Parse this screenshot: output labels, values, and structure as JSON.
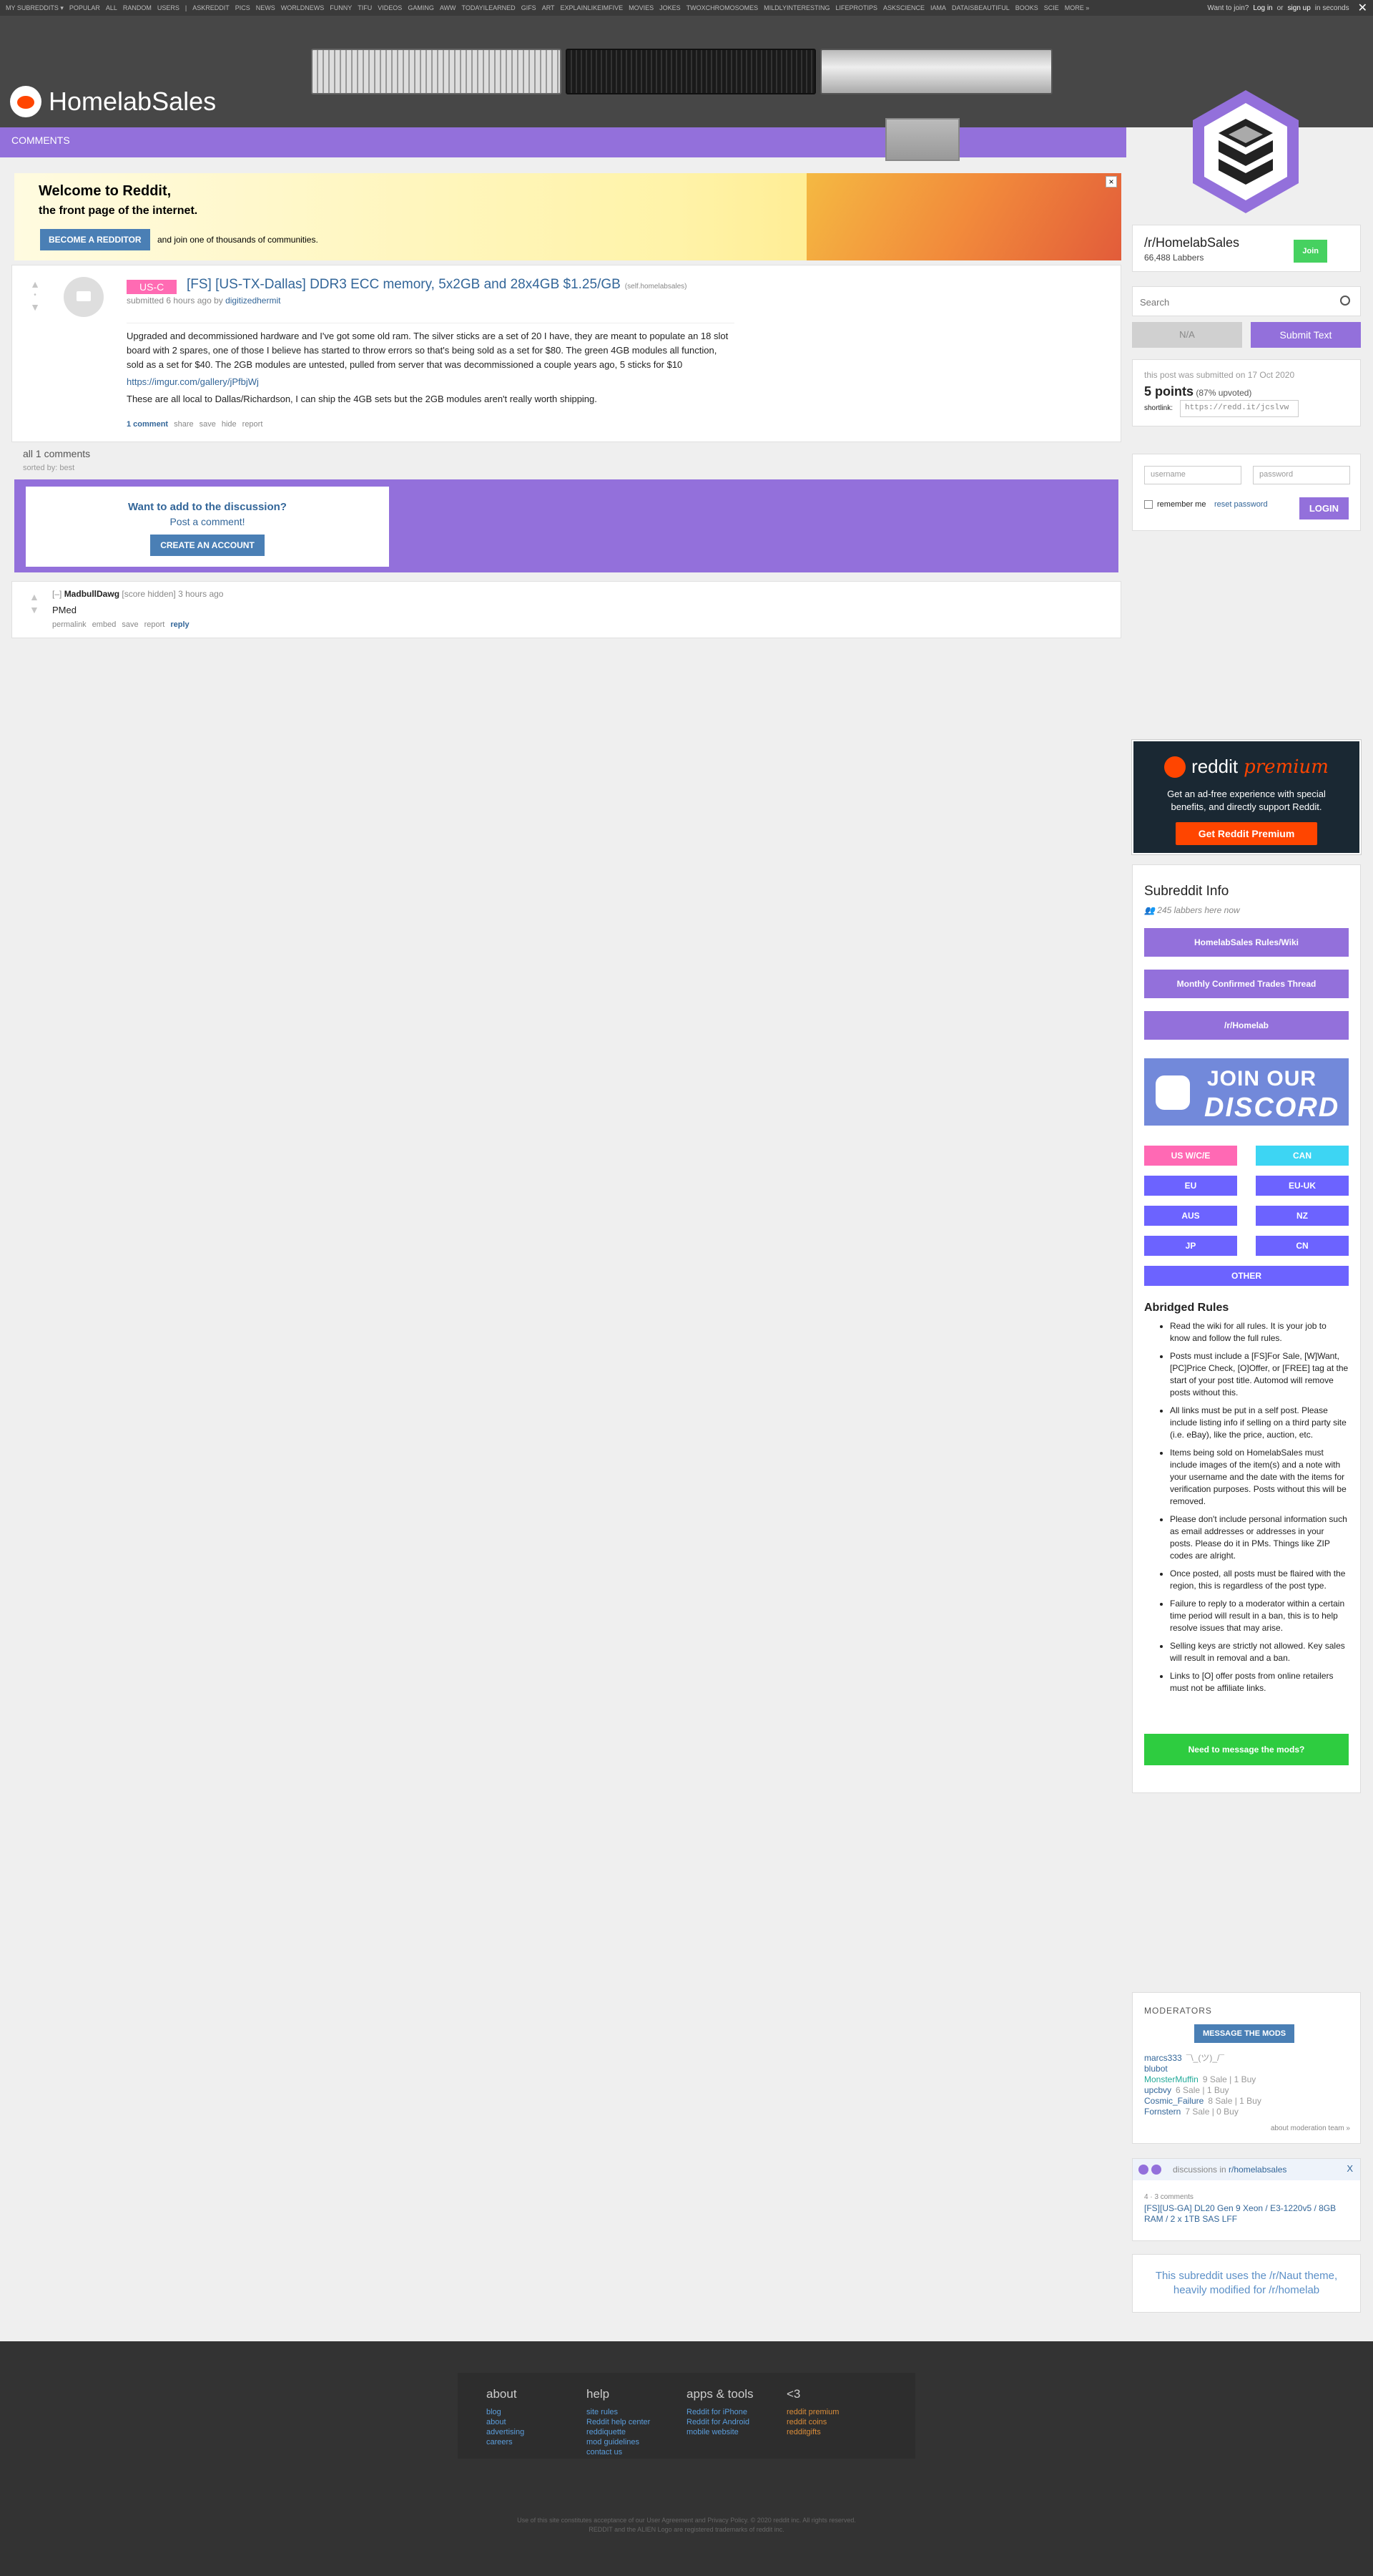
{
  "topbar": {
    "links": [
      "MY SUBREDDITS ▾",
      "POPULAR",
      "ALL",
      "RANDOM",
      "USERS",
      "|",
      "ASKREDDIT",
      "PICS",
      "NEWS",
      "WORLDNEWS",
      "FUNNY",
      "TIFU",
      "VIDEOS",
      "GAMING",
      "AWW",
      "TODAYILEARNED",
      "GIFS",
      "ART",
      "EXPLAINLIKEIMFIVE",
      "MOVIES",
      "JOKES",
      "TWOXCHROMOSOMES",
      "MILDLYINTERESTING",
      "LIFEPROTIPS",
      "ASKSCIENCE",
      "IAMA",
      "DATAISBEAUTIFUL",
      "BOOKS",
      "SCIE",
      "MORE »"
    ],
    "want_join": "Want to join?",
    "login": "Log in",
    "or": "or",
    "signup": "sign up",
    "tail": "in seconds",
    "close": "✕"
  },
  "header": {
    "title": "HomelabSales",
    "tab": "comments"
  },
  "welcome": {
    "title": "Welcome to Reddit,",
    "subtitle": "the front page of the internet.",
    "button": "Become a Redditor",
    "join": "and join one of thousands of communities.",
    "close": "×"
  },
  "post": {
    "flair": "US-C",
    "title": "[FS] [US-TX-Dallas] DDR3 ECC memory, 5x2GB and 28x4GB $1.25/GB",
    "domain": "(self.homelabsales)",
    "submitted": "submitted 6 hours ago by",
    "author": "digitizedhermit",
    "body1": "Upgraded and decommissioned hardware and I've got some old ram. The silver sticks are a set of 20 I have, they are meant to populate an 18 slot board with 2 spares, one of those I believe has started to throw errors so that's being sold as a set for $80. The green 4GB modules all function, sold as a set for $40. The 2GB modules are untested, pulled from server that was decommissioned a couple years ago, 5 sticks for $10",
    "link": "https://imgur.com/gallery/jPfbjWj",
    "body2": "These are all local to Dallas/Richardson, I can ship the 4GB sets but the 2GB modules aren't really worth shipping.",
    "score": "•",
    "actions": {
      "comments": "1 comment",
      "share": "share",
      "save": "save",
      "hide": "hide",
      "report": "report"
    }
  },
  "comments_area": {
    "all": "all 1 comments",
    "sorted": "sorted by: best",
    "discuss_q": "Want to add to the discussion?",
    "post_comment": "Post a comment!",
    "create": "Create an account"
  },
  "comment": {
    "toggle": "[–]",
    "author": "MadbullDawg",
    "meta": "[score hidden] 3 hours ago",
    "text": "PMed",
    "actions": {
      "permalink": "permalink",
      "embed": "embed",
      "save": "save",
      "report": "report",
      "reply": "reply"
    }
  },
  "sidebar": {
    "name": "/r/HomelabSales",
    "subscribers": "66,488 Labbers",
    "join": "Join",
    "search_placeholder": "Search",
    "na": "N/A",
    "submit": "Submit Text",
    "submitted_on": "this post was submitted on 17 Oct 2020",
    "points": "5 points",
    "upvoted": "(87% upvoted)",
    "shortlink_label": "shortlink:",
    "shortlink": "https://redd.it/jcslvw",
    "username_ph": "username",
    "password_ph": "password",
    "remember": "remember me",
    "reset": "reset password",
    "login": "LOGIN"
  },
  "premium": {
    "reddit": "reddit",
    "premium": "premium",
    "desc": "Get an ad-free experience with special benefits, and directly support Reddit.",
    "button": "Get Reddit Premium"
  },
  "subinfo": {
    "title": "Subreddit Info",
    "here": "245 labbers here now",
    "buttons": [
      "HomelabSales Rules/Wiki",
      "Monthly Confirmed Trades Thread",
      "/r/Homelab"
    ],
    "discord_1": "JOIN OUR",
    "discord_2": "DISCORD",
    "regions": [
      "US W/C/E",
      "CAN",
      "EU",
      "EU-UK",
      "AUS",
      "NZ",
      "JP",
      "CN",
      "OTHER"
    ],
    "rules_title": "Abridged Rules",
    "rules": [
      "Read the wiki for all rules. It is your job to know and follow the full rules.",
      "Posts must include a [FS]For Sale, [W]Want, [PC]Price Check, [O]Offer, or [FREE] tag at the start of your post title. Automod will remove posts without this.",
      "All links must be put in a self post. Please include listing info if selling on a third party site (i.e. eBay), like the price, auction, etc.",
      "Items being sold on HomelabSales must include images of the item(s) and a note with your username and the date with the items for verification purposes. Posts without this will be removed.",
      "Please don't include personal information such as email addresses or addresses in your posts. Please do it in PMs. Things like ZIP codes are alright.",
      "Once posted, all posts must be flaired with the region, this is regardless of the post type.",
      "Failure to reply to a moderator within a certain time period will result in a ban, this is to help resolve issues that may arise.",
      "Selling keys are strictly not allowed. Key sales will result in removal and a ban.",
      "Links to [O] offer posts from online retailers must not be affiliate links."
    ],
    "need_mods": "Need to message the mods?"
  },
  "mods": {
    "title": "MODERATORS",
    "message": "MESSAGE THE MODS",
    "list": [
      {
        "name": "marcs333",
        "flair": "¯\\_(ツ)_/¯"
      },
      {
        "name": "blubot",
        "flair": ""
      },
      {
        "name": "MonsterMuffin",
        "flair": "9 Sale | 1 Buy"
      },
      {
        "name": "upcbvy",
        "flair": "6 Sale | 1 Buy"
      },
      {
        "name": "Cosmic_Failure",
        "flair": "8 Sale | 1 Buy"
      },
      {
        "name": "Fornstern",
        "flair": "7 Sale | 0 Buy"
      }
    ],
    "about": "about moderation team »"
  },
  "discussions": {
    "label": "discussions in",
    "sub": "r/homelabsales",
    "count": "4 · 3 comments",
    "link": "[FS][US-GA] DL20 Gen 9 Xeon / E3-1220v5 / 8GB RAM / 2 x 1TB SAS LFF",
    "close": "X"
  },
  "theme_note": "This subreddit uses the /r/Naut theme, heavily modified for /r/homelab",
  "footer": {
    "cols": [
      {
        "h": "about",
        "items": [
          "blog",
          "about",
          "advertising",
          "careers"
        ]
      },
      {
        "h": "help",
        "items": [
          "site rules",
          "Reddit help center",
          "reddiquette",
          "mod guidelines",
          "contact us"
        ]
      },
      {
        "h": "apps & tools",
        "items": [
          "Reddit for iPhone",
          "Reddit for Android",
          "mobile website"
        ]
      },
      {
        "h": "<3",
        "items": [
          "reddit premium",
          "reddit coins",
          "redditgifts"
        ]
      }
    ],
    "legal1": "Use of this site constitutes acceptance of our User Agreement and Privacy Policy. © 2020 reddit inc. All rights reserved.",
    "legal2": "REDDIT and the ALIEN Logo are registered trademarks of reddit inc."
  },
  "colors": {
    "accent": "#9370db",
    "link": "#336699",
    "join": "#46d160",
    "premium": "#ff4500"
  }
}
